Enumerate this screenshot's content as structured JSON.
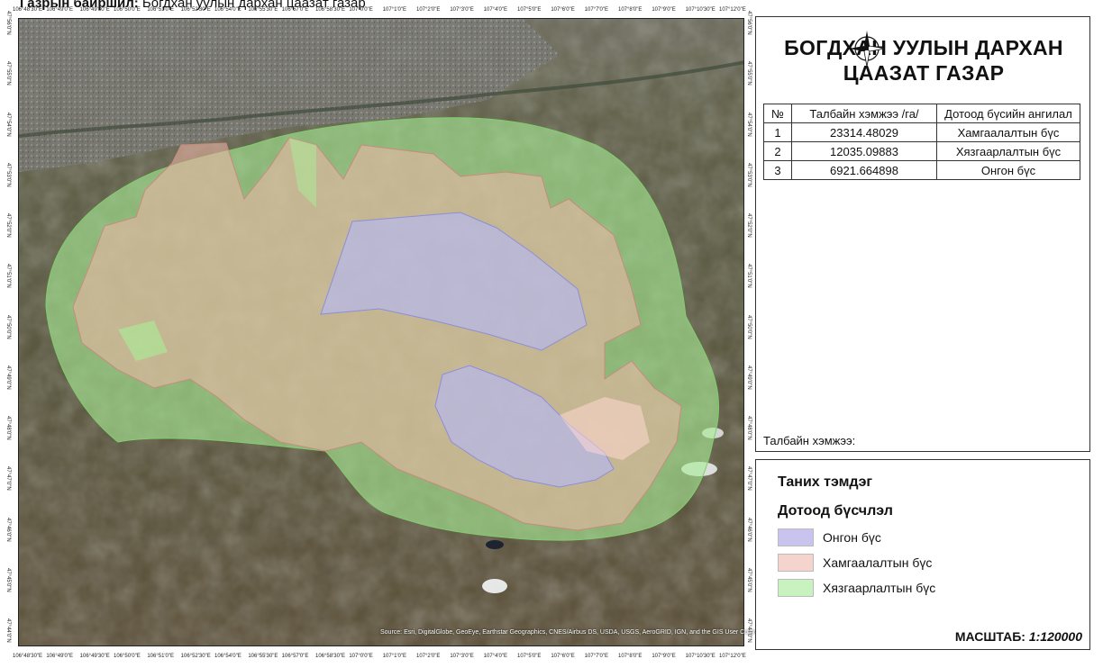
{
  "location": {
    "label": "Газрын байршил:",
    "value": "Богдхан уулын дархан цаазат газар"
  },
  "info": {
    "title_line1": "БОГДХАН УУЛЫН ДАРХАН",
    "title_line2": "ЦААЗАТ ГАЗАР",
    "table": {
      "headers": [
        "№",
        "Талбайн хэмжээ /га/",
        "Дотоод бүсийн ангилал"
      ],
      "rows": [
        [
          "1",
          "23314.48029",
          "Хамгаалалтын бүс"
        ],
        [
          "2",
          "12035.09883",
          "Хязгаарлалтын бүс"
        ],
        [
          "3",
          "6921.664898",
          "Онгон бүс"
        ]
      ]
    },
    "area_label": "Талбайн хэмжээ:"
  },
  "legend": {
    "title": "Таних тэмдэг",
    "subtitle": "Дотоод бүсчлэл",
    "items": [
      {
        "label": "Онгон бүс",
        "color": "#c8c4ee"
      },
      {
        "label": "Хамгаалалтын бүс",
        "color": "#f6d4ce"
      },
      {
        "label": "Хязгаарлалтын бүс",
        "color": "#c9f2c1"
      }
    ],
    "scale_label": "МАСШТАБ:",
    "scale_value": "1:120000"
  },
  "map": {
    "zone_colors": {
      "restricted": "#a8ee96",
      "protected": "#f2b6a8",
      "pristine": "#b6b8f4"
    },
    "credit": "Source: Esri, DigitalGlobe, GeoEye, Earthstar Geographics, CNES/Airbus DS, USDA, USGS, AeroGRID, IGN, and the GIS User Community"
  },
  "longitude_ticks": [
    "106°48'30\"E",
    "106°49'0\"E",
    "106°49'30\"E",
    "106°50'0\"E",
    "106°51'0\"E",
    "106°52'30\"E",
    "106°54'0\"E",
    "106°55'30\"E",
    "106°57'0\"E",
    "106°58'30\"E",
    "107°0'0\"E",
    "107°1'0\"E",
    "107°2'0\"E",
    "107°3'0\"E",
    "107°4'0\"E",
    "107°5'0\"E",
    "107°6'0\"E",
    "107°7'0\"E",
    "107°8'0\"E",
    "107°9'0\"E",
    "107°10'30\"E",
    "107°12'0\"E"
  ],
  "latitude_ticks": [
    "47°56'0\"N",
    "47°55'0\"N",
    "47°54'0\"N",
    "47°53'0\"N",
    "47°52'0\"N",
    "47°51'0\"N",
    "47°50'0\"N",
    "47°49'0\"N",
    "47°48'0\"N",
    "47°47'0\"N",
    "47°46'0\"N",
    "47°45'0\"N",
    "47°44'0\"N"
  ]
}
